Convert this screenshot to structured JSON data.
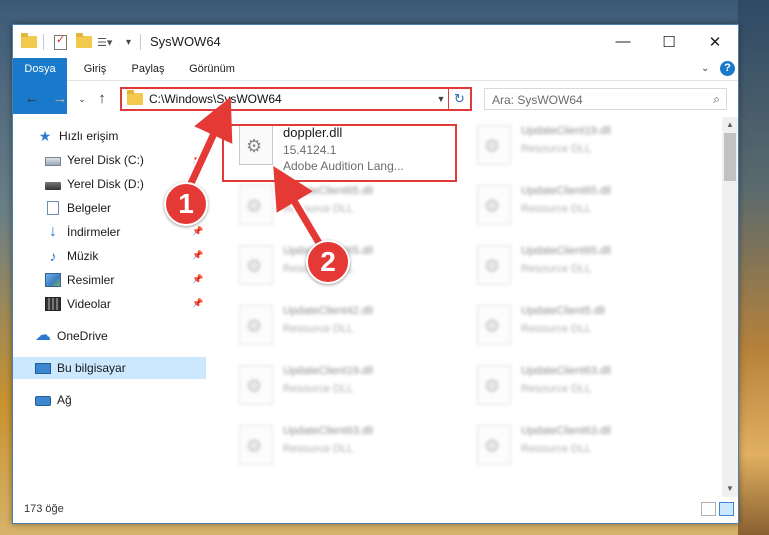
{
  "window": {
    "title": "SysWOW64"
  },
  "ribbon": {
    "tabs": [
      {
        "label": "Dosya"
      },
      {
        "label": "Giriş"
      },
      {
        "label": "Paylaş"
      },
      {
        "label": "Görünüm"
      }
    ],
    "help": "?"
  },
  "nav": {
    "address": "C:\\Windows\\SysWOW64",
    "search_placeholder": "Ara: SysWOW64"
  },
  "sidebar": {
    "items": [
      {
        "label": "Hızlı erişim",
        "icon": "star-icon"
      },
      {
        "label": "Yerel Disk (C:)",
        "icon": "drive-icon",
        "pinned": true
      },
      {
        "label": "Yerel Disk (D:)",
        "icon": "drive-icon",
        "pinned": false
      },
      {
        "label": "Belgeler",
        "icon": "documents-icon",
        "pinned": true
      },
      {
        "label": "İndirmeler",
        "icon": "downloads-icon",
        "pinned": true
      },
      {
        "label": "Müzik",
        "icon": "music-icon",
        "pinned": true
      },
      {
        "label": "Resimler",
        "icon": "pictures-icon",
        "pinned": true
      },
      {
        "label": "Videolar",
        "icon": "videos-icon",
        "pinned": true
      },
      {
        "label": "OneDrive",
        "icon": "cloud-icon"
      },
      {
        "label": "Bu bilgisayar",
        "icon": "computer-icon",
        "selected": true
      },
      {
        "label": "Ağ",
        "icon": "network-icon"
      }
    ]
  },
  "files": {
    "highlighted": {
      "name": "doppler.dll",
      "version": "15.4124.1",
      "description": "Adobe Audition Lang..."
    },
    "others": [
      {
        "name": "UpdateClient19.dll",
        "type": "Resource DLL"
      },
      {
        "name": "UpdateClient65.dll",
        "type": "Resource DLL"
      },
      {
        "name": "UpdateClient65.dll",
        "type": "Resource DLL"
      },
      {
        "name": "UpdateClient65.dll",
        "type": "Resource DLL"
      },
      {
        "name": "UpdateClient65.dll",
        "type": "Resource DLL"
      },
      {
        "name": "UpdateClient42.dll",
        "type": "Resource DLL"
      },
      {
        "name": "UpdateClient5.dll",
        "type": "Resource DLL"
      },
      {
        "name": "UpdateClient19.dll",
        "type": "Resource DLL"
      },
      {
        "name": "UpdateClient63.dll",
        "type": "Resource DLL"
      },
      {
        "name": "UpdateClient63.dll",
        "type": "Resource DLL"
      },
      {
        "name": "UpdateClient63.dll",
        "type": "Resource DLL"
      }
    ]
  },
  "status": {
    "count": "173 öğe"
  },
  "annotations": {
    "step1": "1",
    "step2": "2",
    "color": "#e53935"
  },
  "colors": {
    "accent": "#1979ca",
    "highlight_border": "#e03a3a",
    "selected_bg": "#cce8ff"
  }
}
